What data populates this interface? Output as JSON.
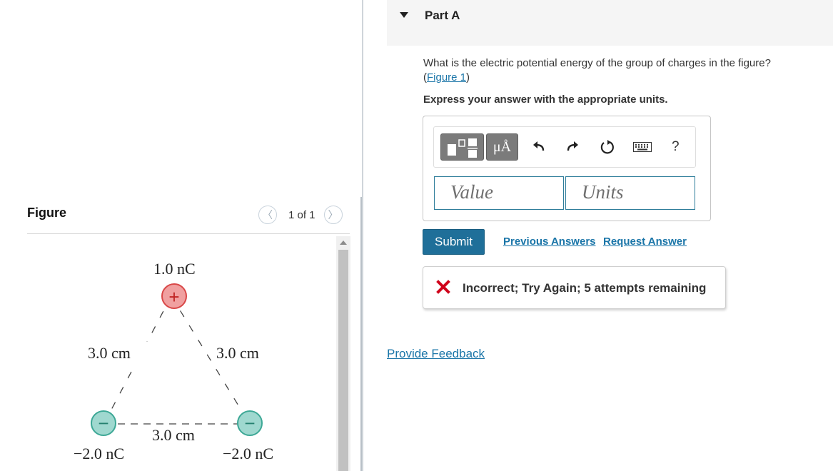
{
  "figure_panel": {
    "title": "Figure",
    "pager_text": "1 of 1",
    "prev_icon": "chevron-left-icon",
    "next_icon": "chevron-right-icon"
  },
  "diagram": {
    "top_charge": "1.0 nC",
    "left_charge": "−2.0 nC",
    "right_charge": "−2.0 nC",
    "left_side": "3.0 cm",
    "right_side": "3.0 cm",
    "bottom_side": "3.0 cm",
    "top_sign": "+",
    "bottom_sign": "−",
    "positive_color": "#f0a0a0",
    "negative_color": "#9fd8cf"
  },
  "part": {
    "title": "Part A",
    "question_text": "What is the electric potential energy of the group of charges in the figure?",
    "figure_link_open": "(",
    "figure_link": "Figure 1",
    "figure_link_close": ")",
    "instruction": "Express your answer with the appropriate units."
  },
  "toolbar": {
    "units_label": "μÅ",
    "help_label": "?",
    "icons": [
      "templates-icon",
      "units-icon",
      "undo-icon",
      "redo-icon",
      "reset-icon",
      "keyboard-icon",
      "help-icon"
    ]
  },
  "inputs": {
    "value_placeholder": "Value",
    "units_placeholder": "Units"
  },
  "actions": {
    "submit": "Submit",
    "previous_answers": "Previous Answers",
    "request_answer": "Request Answer"
  },
  "feedback": {
    "message": "Incorrect; Try Again; 5 attempts remaining",
    "color": "#d0021b"
  },
  "footer": {
    "provide_feedback": "Provide Feedback"
  },
  "colors": {
    "accent": "#1f6f99",
    "link": "#1a75a8"
  }
}
